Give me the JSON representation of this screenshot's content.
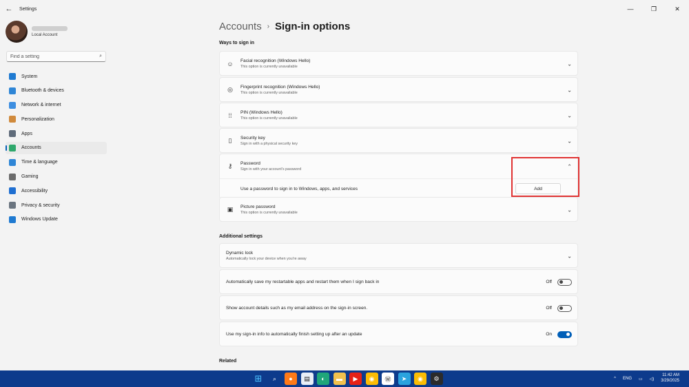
{
  "window": {
    "title": "Settings",
    "back_glyph": "←",
    "controls": [
      "—",
      "❐",
      "✕"
    ]
  },
  "profile": {
    "account_type": "Local Account"
  },
  "search": {
    "placeholder": "Find a setting",
    "icon": "search-icon"
  },
  "nav": {
    "items": [
      {
        "label": "System",
        "color": "#1f7ad1"
      },
      {
        "label": "Bluetooth & devices",
        "color": "#2f86d6"
      },
      {
        "label": "Network & internet",
        "color": "#3d8ee0"
      },
      {
        "label": "Personalization",
        "color": "#d08a3c"
      },
      {
        "label": "Apps",
        "color": "#5f6b7a"
      },
      {
        "label": "Accounts",
        "color": "#2fa86c"
      },
      {
        "label": "Time & language",
        "color": "#2f86d6"
      },
      {
        "label": "Gaming",
        "color": "#6b6b6b"
      },
      {
        "label": "Accessibility",
        "color": "#1f6fd1"
      },
      {
        "label": "Privacy & security",
        "color": "#6b7580"
      },
      {
        "label": "Windows Update",
        "color": "#1f7ad1"
      }
    ],
    "active_index": 5
  },
  "breadcrumb": {
    "parent": "Accounts",
    "separator": "›",
    "current": "Sign-in options"
  },
  "ways": {
    "title": "Ways to sign in",
    "items": [
      {
        "title": "Facial recognition (Windows Hello)",
        "subtitle": "This option is currently unavailable",
        "icon": "☺"
      },
      {
        "title": "Fingerprint recognition (Windows Hello)",
        "subtitle": "This option is currently unavailable",
        "icon": "◎"
      },
      {
        "title": "PIN (Windows Hello)",
        "subtitle": "This option is currently unavailable",
        "icon": "⁞⁞"
      },
      {
        "title": "Security key",
        "subtitle": "Sign in with a physical security key",
        "icon": "▯"
      },
      {
        "title": "Password",
        "subtitle": "Sign in with your account's password",
        "icon": "⚷"
      },
      {
        "title": "Picture password",
        "subtitle": "This option is currently unavailable",
        "icon": "▣"
      }
    ],
    "password_detail": {
      "text": "Use a password to sign in to Windows, apps, and services",
      "button": "Add"
    }
  },
  "additional": {
    "title": "Additional settings",
    "dynamic_lock": {
      "title": "Dynamic lock",
      "subtitle": "Automatically lock your device when you're away"
    },
    "toggles": [
      {
        "label": "Automatically save my restartable apps and restart them when I sign back in",
        "state": "Off",
        "on": false
      },
      {
        "label": "Show account details such as my email address on the sign-in screen.",
        "state": "Off",
        "on": false
      },
      {
        "label": "Use my sign-in info to automatically finish setting up after an update",
        "state": "On",
        "on": true
      }
    ]
  },
  "related": {
    "title": "Related"
  },
  "taskbar": {
    "icons": [
      "windows-start-icon",
      "search-icon",
      "firefox-icon",
      "file-icon",
      "edge-icon",
      "file-explorer-icon",
      "youtube-icon",
      "chrome-icon",
      "wordpress-icon",
      "telegram-icon",
      "chrome-icon",
      "settings-icon"
    ],
    "tray": {
      "chevron": "^",
      "language": "ENG",
      "time": "11:42 AM",
      "date": "3/29/2025"
    }
  }
}
